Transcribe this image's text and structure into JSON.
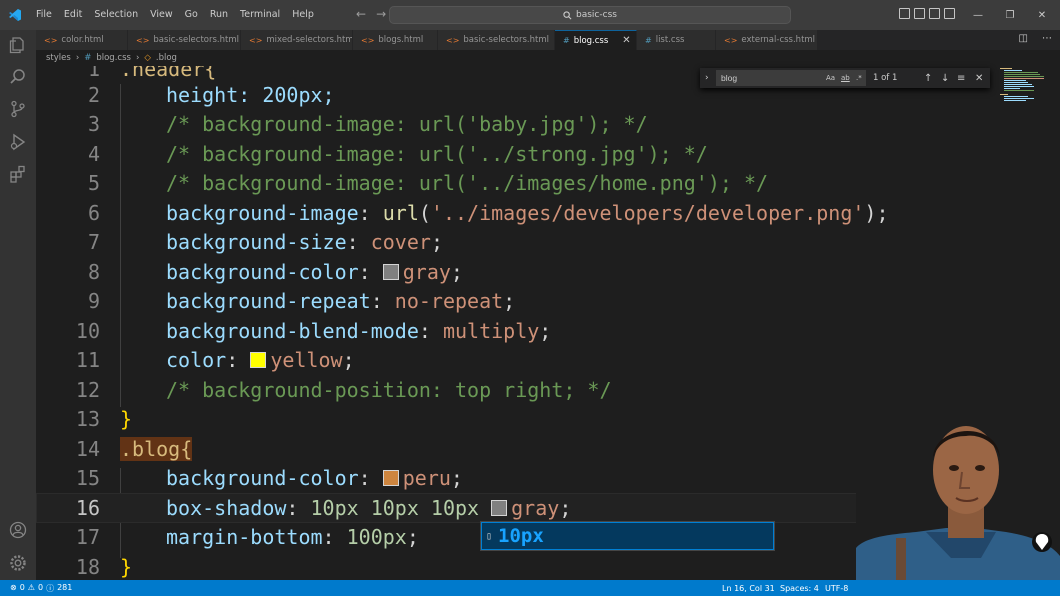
{
  "menu": [
    "File",
    "Edit",
    "Selection",
    "View",
    "Go",
    "Run",
    "Terminal",
    "Help"
  ],
  "search": {
    "value": "basic-css"
  },
  "tabs": [
    {
      "label": "color.html",
      "icon": "html-file-icon",
      "active": false
    },
    {
      "label": "basic-selectors.html",
      "icon": "html-file-icon",
      "active": false
    },
    {
      "label": "mixed-selectors.html",
      "icon": "html-file-icon",
      "active": false
    },
    {
      "label": "blogs.html",
      "icon": "html-file-icon",
      "active": false
    },
    {
      "label": "basic-selectors.html",
      "icon": "html-file-icon",
      "active": false
    },
    {
      "label": "blog.css",
      "icon": "css-file-icon",
      "active": true
    },
    {
      "label": "list.css",
      "icon": "css-file-icon",
      "active": false
    },
    {
      "label": "external-css.html",
      "icon": "html-file-icon",
      "active": false
    }
  ],
  "breadcrumb": {
    "folder": "styles",
    "file": "blog.css",
    "symbol": ".blog"
  },
  "find": {
    "query": "blog",
    "result": "1 of 1",
    "toggles": [
      "Aa",
      "ab",
      ".*"
    ]
  },
  "editor": {
    "lines": [
      {
        "n": "1",
        "text": ".header{"
      },
      {
        "n": "2",
        "text": "height: 200px;"
      },
      {
        "n": "3",
        "text": "/* background-image: url('baby.jpg'); */"
      },
      {
        "n": "4",
        "text": "/* background-image: url('../strong.jpg'); */"
      },
      {
        "n": "5",
        "text": "/* background-image: url('../images/home.png'); */"
      },
      {
        "n": "6",
        "prop": "background-image",
        "fn": "url",
        "arg": "'../images/developers/developer.png'"
      },
      {
        "n": "7",
        "prop": "background-size",
        "value": "cover"
      },
      {
        "n": "8",
        "prop": "background-color",
        "value": "gray",
        "swatch": "#808080"
      },
      {
        "n": "9",
        "prop": "background-repeat",
        "value": "no-repeat"
      },
      {
        "n": "10",
        "prop": "background-blend-mode",
        "value": "multiply"
      },
      {
        "n": "11",
        "prop": "color",
        "value": "yellow",
        "swatch": "#ffff00"
      },
      {
        "n": "12",
        "text": "/* background-position: top right; */"
      },
      {
        "n": "13",
        "text": "}"
      },
      {
        "n": "14",
        "text": ".blog{"
      },
      {
        "n": "15",
        "prop": "background-color",
        "value": "peru",
        "swatch": "#cd853f"
      },
      {
        "n": "16",
        "prop": "box-shadow",
        "value": "10px 10px 10px",
        "value2": "gray",
        "swatch": "#808080"
      },
      {
        "n": "17",
        "prop": "margin-bottom",
        "value": "100px"
      },
      {
        "n": "18",
        "text": "}"
      }
    ]
  },
  "suggestion": {
    "label": "10px"
  },
  "status": {
    "errors": "0",
    "warnings": "0",
    "info": "281",
    "position": "Ln 16, Col 31",
    "spaces": "Spaces: 4",
    "encoding": "UTF-8"
  },
  "colors": {
    "accent": "#007acc",
    "statusbar": "#007acc",
    "editor_bg": "#1e1e1e"
  }
}
